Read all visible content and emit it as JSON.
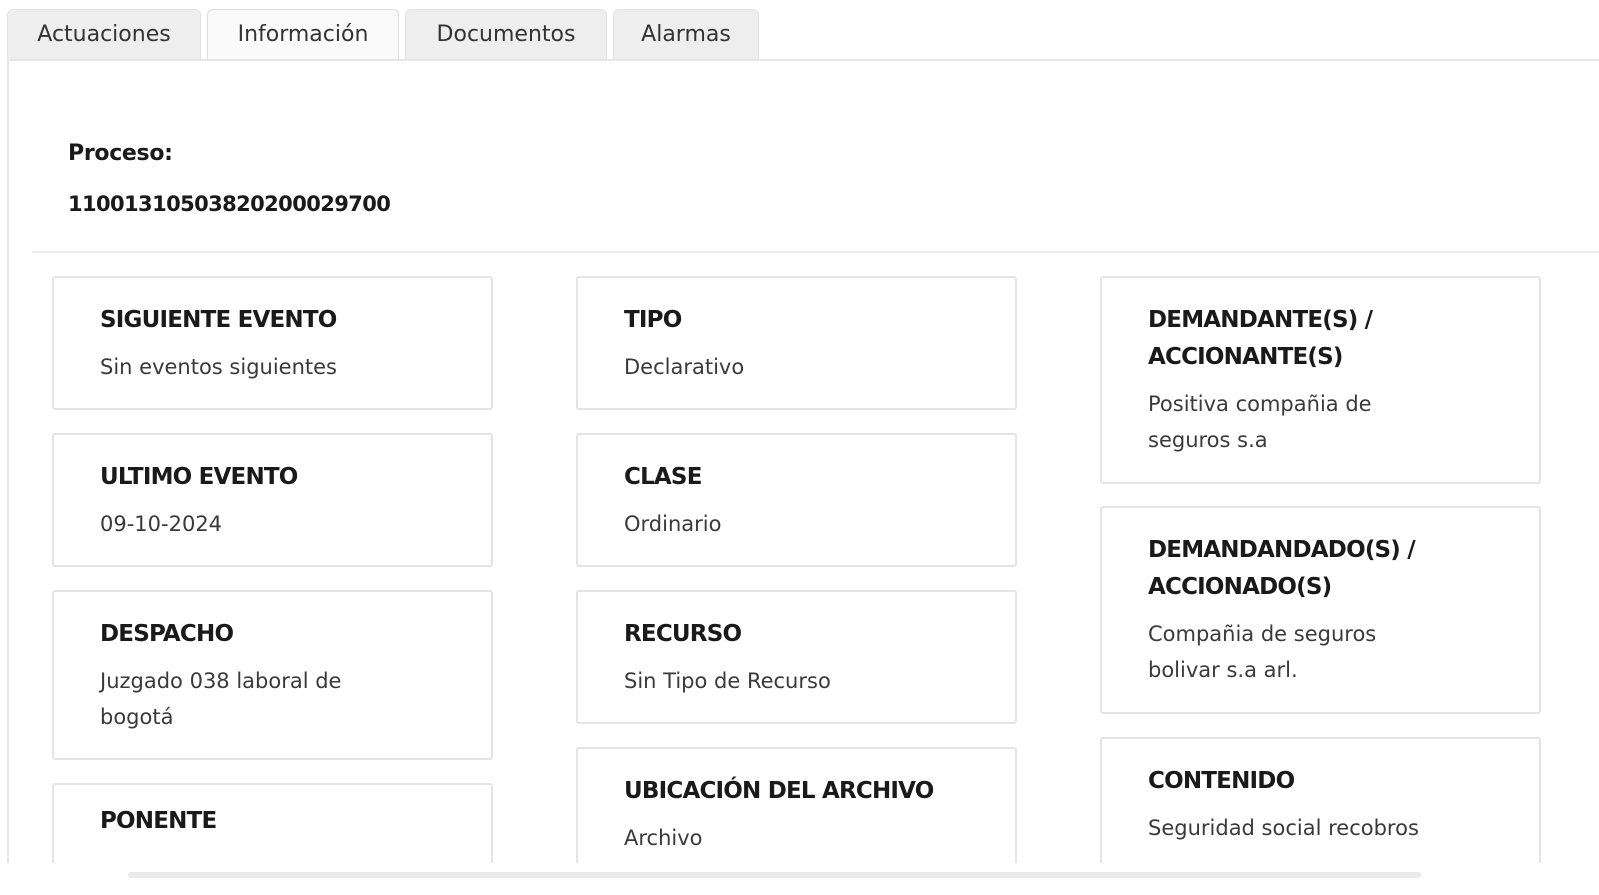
{
  "tabs": [
    {
      "label": "Actuaciones",
      "active": false
    },
    {
      "label": "Información",
      "active": true
    },
    {
      "label": "Documentos",
      "active": false
    },
    {
      "label": "Alarmas",
      "active": false
    }
  ],
  "proceso": {
    "label": "Proceso:",
    "number": "11001310503820200029700"
  },
  "cards": {
    "siguiente_evento": {
      "title": "SIGUIENTE EVENTO",
      "value": "Sin eventos siguientes"
    },
    "ultimo_evento": {
      "title": "ULTIMO EVENTO",
      "value": "09-10-2024"
    },
    "despacho": {
      "title": "DESPACHO",
      "value": "Juzgado 038 laboral de bogotá"
    },
    "ponente": {
      "title": "PONENTE",
      "value": ""
    },
    "tipo": {
      "title": "TIPO",
      "value": "Declarativo"
    },
    "clase": {
      "title": "CLASE",
      "value": "Ordinario"
    },
    "recurso": {
      "title": "RECURSO",
      "value": "Sin Tipo de Recurso"
    },
    "ubicacion": {
      "title": "UBICACIÓN DEL ARCHIVO",
      "value": "Archivo"
    },
    "demandantes": {
      "title": "DEMANDANTE(S) / ACCIONANTE(S)",
      "value": "Positiva compañia de seguros s.a"
    },
    "demandados": {
      "title": "DEMANDANDADO(S) / ACCIONADO(S)",
      "value": "Compañia de seguros bolivar s.a arl."
    },
    "contenido": {
      "title": "CONTENIDO",
      "value": "Seguridad social recobros"
    }
  }
}
